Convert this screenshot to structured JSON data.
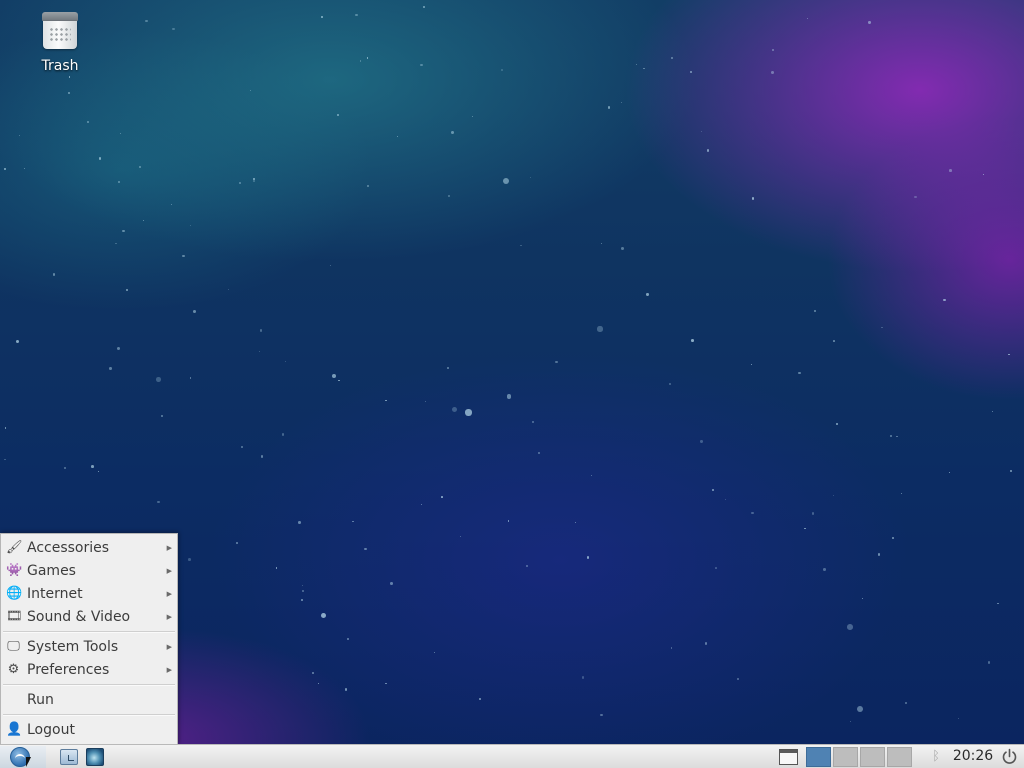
{
  "desktop": {
    "icons": [
      {
        "label": "Trash",
        "icon": "trash-icon"
      }
    ]
  },
  "menu": {
    "items": [
      {
        "label": "Accessories",
        "icon": "accessories-icon",
        "submenu": true
      },
      {
        "label": "Games",
        "icon": "games-icon",
        "submenu": true
      },
      {
        "label": "Internet",
        "icon": "internet-icon",
        "submenu": true
      },
      {
        "label": "Sound & Video",
        "icon": "sound-video-icon",
        "submenu": true
      },
      {
        "label": "System Tools",
        "icon": "system-tools-icon",
        "submenu": true
      },
      {
        "label": "Preferences",
        "icon": "preferences-icon",
        "submenu": true
      },
      {
        "label": "Run",
        "icon": "",
        "submenu": false
      },
      {
        "label": "Logout",
        "icon": "logout-icon",
        "submenu": false
      }
    ]
  },
  "taskbar": {
    "start_icon": "start-menu-logo-icon",
    "launchers": [
      "file-manager-icon",
      "web-browser-icon"
    ],
    "show_desktop_icon": "show-desktop-icon",
    "workspaces": {
      "count": 4,
      "active_index": 0
    },
    "tray_icons": [
      "bluetooth-icon",
      "power-icon"
    ],
    "clock": "20:26"
  },
  "colors": {
    "menu_background": "#efefef",
    "taskbar_background": "#dcdcdc",
    "active_workspace": "#4f82b3",
    "desktop_background": "#0f3461",
    "wallpaper_glow": "#9628be"
  }
}
